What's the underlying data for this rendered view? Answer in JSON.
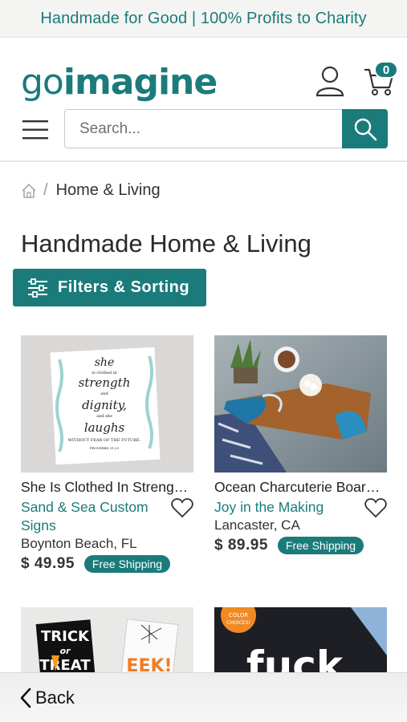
{
  "announcement": "Handmade for Good | 100% Profits to Charity",
  "logo": {
    "go": "go",
    "imagine": "imagine"
  },
  "cart": {
    "count": "0"
  },
  "search": {
    "placeholder": "Search..."
  },
  "breadcrumb": {
    "separator": "/",
    "current": "Home & Living"
  },
  "page_title": "Handmade Home & Living",
  "filters_label": "Filters & Sorting",
  "products": [
    {
      "title": "She Is Clothed In Strength Dignity…",
      "shop": "Sand & Sea Custom Signs",
      "location": "Boynton Beach, FL",
      "price": "$ 49.95",
      "badge": "Free Shipping",
      "image_text": [
        "she",
        "is clothed in",
        "strength",
        "and",
        "dignity,",
        "and she",
        "laughs",
        "WITHOUT FEAR OF THE FUTURE.",
        "PROVERBS 31:25"
      ]
    },
    {
      "title": "Ocean Charcuterie Board…",
      "shop": "Joy in the Making",
      "location": "Lancaster, CA",
      "price": "$ 89.95",
      "badge": "Free Shipping"
    },
    {
      "image_text": [
        "TRICK",
        "or",
        "TREAT",
        "EEK!"
      ]
    },
    {
      "image_text": [
        "COLOR",
        "CHOICES!",
        "fuck"
      ]
    }
  ],
  "back_label": "Back",
  "colors": {
    "brand": "#1b7b7b"
  }
}
